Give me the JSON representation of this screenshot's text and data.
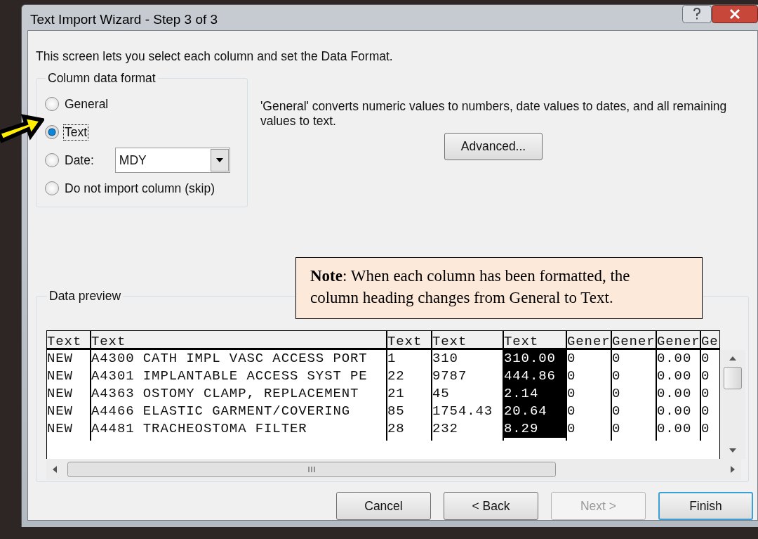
{
  "window": {
    "title": "Text Import Wizard - Step 3 of 3"
  },
  "intro": "This screen lets you select each column and set the Data Format.",
  "column_data_format": {
    "title": "Column data format",
    "options": [
      {
        "label": "General",
        "selected": false,
        "focused": false
      },
      {
        "label": "Text",
        "selected": true,
        "focused": true
      },
      {
        "label": "Date:",
        "selected": false,
        "focused": false,
        "dropdown": {
          "value": "MDY"
        }
      },
      {
        "label": "Do not import column (skip)",
        "selected": false,
        "focused": false
      }
    ]
  },
  "description": "'General' converts numeric values to numbers, date values to dates, and all remaining values to text.",
  "advanced_button": "Advanced...",
  "note": "**Note**: When each column has been formatted, the column heading changes from General to Text.",
  "data_preview": {
    "title": "Data preview",
    "columns": [
      {
        "heading": "Text",
        "selected": false
      },
      {
        "heading": "Text",
        "selected": false
      },
      {
        "heading": "Text",
        "selected": false
      },
      {
        "heading": "Text",
        "selected": false
      },
      {
        "heading": "Text",
        "selected": true
      },
      {
        "heading": "Gener",
        "selected": false
      },
      {
        "heading": "Gener",
        "selected": false
      },
      {
        "heading": "Gener",
        "selected": false
      },
      {
        "heading": "Ge",
        "selected": false
      }
    ],
    "rows": [
      [
        "NEW",
        "A4300 CATH IMPL VASC ACCESS PORT",
        "1",
        "310",
        "310.00",
        "0",
        "0",
        "0.00",
        "0"
      ],
      [
        "NEW",
        "A4301 IMPLANTABLE ACCESS SYST PE",
        "22",
        "9787",
        "444.86",
        "0",
        "0",
        "0.00",
        "0"
      ],
      [
        "NEW",
        "A4363 OSTOMY CLAMP, REPLACEMENT",
        "21",
        "45",
        "2.14",
        "0",
        "0",
        "0.00",
        "0"
      ],
      [
        "NEW",
        "A4466 ELASTIC GARMENT/COVERING",
        "85",
        "1754.43",
        "20.64",
        "0",
        "0",
        "0.00",
        "0"
      ],
      [
        "NEW",
        "A4481 TRACHEOSTOMA FILTER",
        "28",
        "232",
        "8.29",
        "0",
        "0",
        "0.00",
        "0"
      ]
    ]
  },
  "buttons": [
    {
      "label": "Cancel",
      "disabled": false,
      "default": false
    },
    {
      "label": "< Back",
      "disabled": false,
      "default": false
    },
    {
      "label": "Next >",
      "disabled": true,
      "default": false
    },
    {
      "label": "Finish",
      "disabled": false,
      "default": true
    }
  ]
}
